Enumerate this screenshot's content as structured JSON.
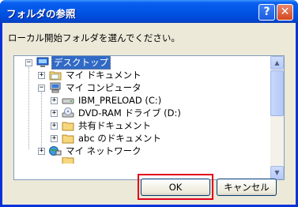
{
  "window": {
    "title": "フォルダの参照",
    "help_label": "?",
    "close_label": "✕"
  },
  "instruction": "ローカル開始フォルダを選んでください。",
  "tree": {
    "items": [
      {
        "label": "デスクトップ",
        "expander": "−",
        "icon": "desktop-icon",
        "selected": true
      },
      {
        "label": "マイ ドキュメント",
        "expander": "+",
        "icon": "folder-icon"
      },
      {
        "label": "マイ コンピュータ",
        "expander": "−",
        "icon": "computer-icon"
      },
      {
        "label": "IBM_PRELOAD (C:)",
        "expander": "+",
        "icon": "hard-drive-icon"
      },
      {
        "label": "DVD-RAM ドライブ (D:)",
        "expander": "+",
        "icon": "dvd-drive-icon"
      },
      {
        "label": "共有ドキュメント",
        "expander": "+",
        "icon": "folder-icon"
      },
      {
        "label": "abc のドキュメント",
        "expander": "+",
        "icon": "folder-icon"
      },
      {
        "label": "マイ ネットワーク",
        "expander": "+",
        "icon": "network-icon"
      }
    ]
  },
  "buttons": {
    "ok_label": "OK",
    "cancel_label": "キャンセル"
  },
  "colors": {
    "titlebar": "#0055e5",
    "selection": "#316ac5",
    "highlight": "#e0001a"
  }
}
